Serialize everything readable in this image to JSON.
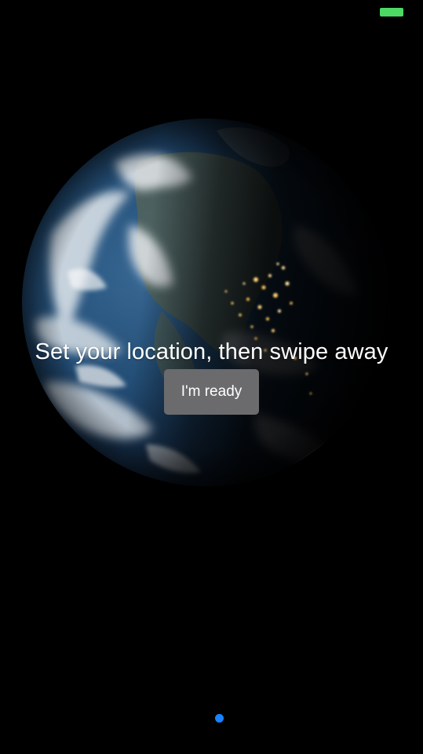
{
  "status_bar": {
    "battery_color": "#4cd964"
  },
  "globe": {
    "icon": "earth-globe-night-image"
  },
  "onboarding": {
    "headline": "Set your location, then swipe away",
    "ready_button_label": "I'm ready",
    "button_color": "#6b6b6e"
  },
  "pager": {
    "page_count": 1,
    "active_index": 0,
    "active_color": "#1a82ff"
  }
}
